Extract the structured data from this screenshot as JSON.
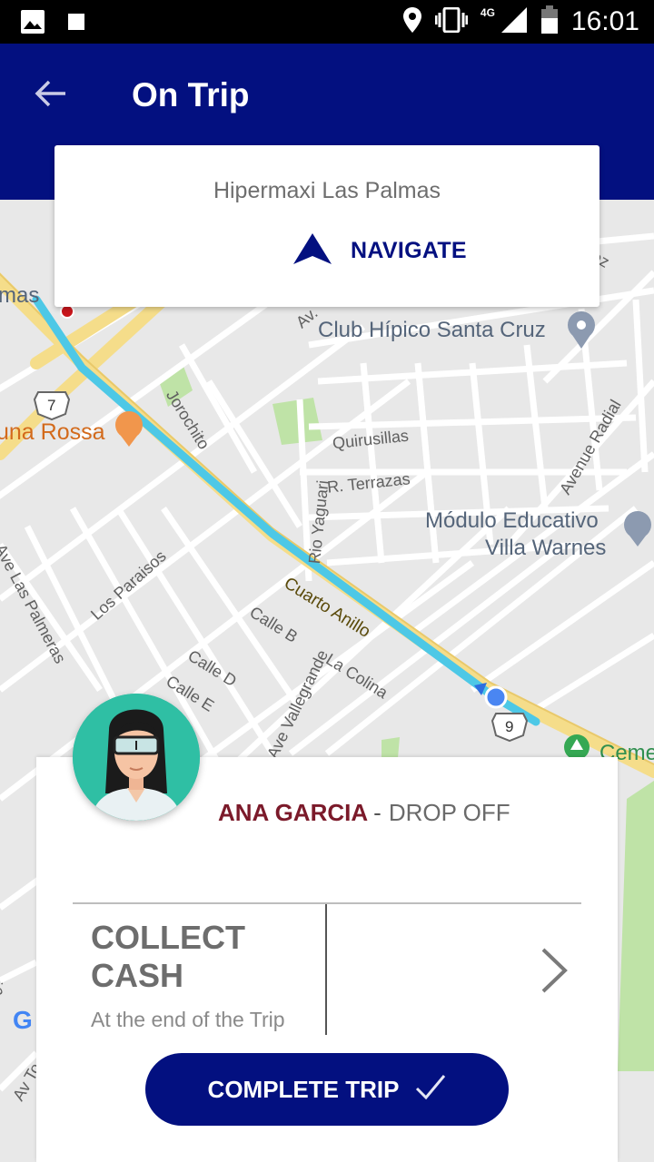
{
  "status_bar": {
    "time": "16:01",
    "network": "4G",
    "icons": [
      "image-icon",
      "square-icon",
      "location-icon",
      "vibrate-icon",
      "signal-icon",
      "battery-icon"
    ]
  },
  "app_bar": {
    "title": "On Trip",
    "back_icon": "arrow-back-icon",
    "background": "#031080"
  },
  "destination": {
    "name": "Hipermaxi Las Palmas",
    "navigate_label": "NAVIGATE",
    "navigate_icon": "navigation-arrow-icon"
  },
  "map": {
    "labels": {
      "club": "Club Hípico Santa Cruz",
      "modulo_line1": "Módulo Educativo",
      "modulo_line2": "Villa Warnes",
      "una_rossa": "una Rossa",
      "mas": "mas",
      "jorochito": "Jorochito",
      "quirusillas": "Quirusillas",
      "terrazas": "R. Terrazas",
      "avenue_radial": "Avenue Radial",
      "rio_yaguari": "Rio Yaguari",
      "los_paraisos": "Los Paraisos",
      "ave_las_palmeras": "Ave Las Palmeras",
      "cuarto_anillo": "Cuarto Anillo",
      "calle_b": "Calle B",
      "la_colina": "La Colina",
      "calle_d": "Calle D",
      "calle_e": "Calle E",
      "ave_vallegrande": "Ave Vallegrande",
      "ceme": "Ceme",
      "av_dot": "Av.",
      "ez": "ez",
      "cia": "cia",
      "av_to": "Av To",
      "route_7": "7",
      "route_9": "9",
      "google_g": "G"
    },
    "route_color": "#4dc8e6",
    "road_color": "#f7e08a"
  },
  "rider": {
    "name": "ANA GARCIA",
    "separator": "-",
    "trip_type": "DROP OFF",
    "avatar_icon": "rider-avatar-icon"
  },
  "payment": {
    "title": "COLLECT CASH",
    "subtitle": "At the end of the Trip",
    "chevron_icon": "chevron-right-icon"
  },
  "actions": {
    "complete_label": "COMPLETE TRIP",
    "complete_icon": "check-icon"
  }
}
